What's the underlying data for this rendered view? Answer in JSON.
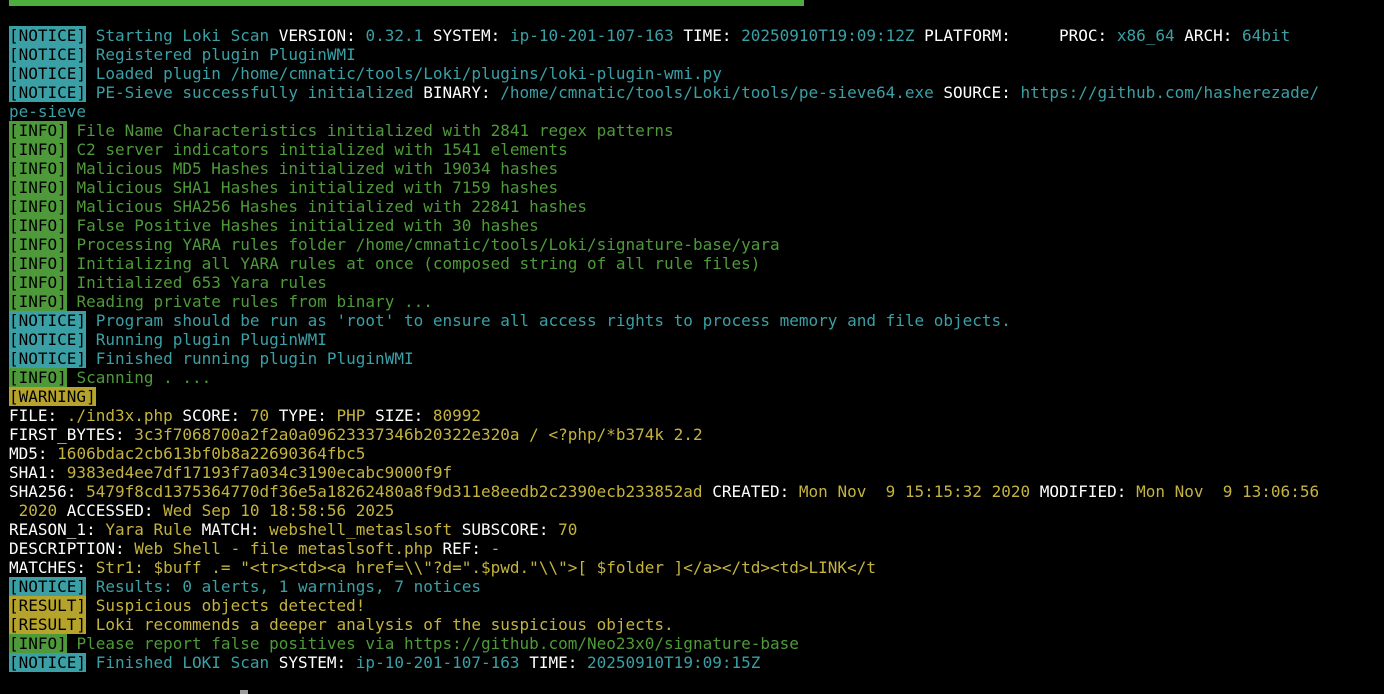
{
  "progress": {
    "fraction": 0.58
  },
  "lines": [
    [
      [
        "notice",
        "[NOTICE]"
      ],
      [
        "sp",
        " "
      ],
      [
        "nm",
        "Starting Loki Scan "
      ],
      [
        "k",
        "VERSION: "
      ],
      [
        "v",
        "0.32.1 "
      ],
      [
        "k",
        "SYSTEM: "
      ],
      [
        "v",
        "ip-10-201-107-163 "
      ],
      [
        "k",
        "TIME: "
      ],
      [
        "v",
        "20250910T19:09:12Z "
      ],
      [
        "k",
        "PLATFORM:     "
      ],
      [
        "k",
        "PROC: "
      ],
      [
        "v",
        "x86_64 "
      ],
      [
        "k",
        "ARCH: "
      ],
      [
        "v",
        "64bit"
      ]
    ],
    [
      [
        "notice",
        "[NOTICE]"
      ],
      [
        "sp",
        " "
      ],
      [
        "nm",
        "Registered plugin PluginWMI"
      ]
    ],
    [
      [
        "notice",
        "[NOTICE]"
      ],
      [
        "sp",
        " "
      ],
      [
        "nm",
        "Loaded plugin /home/cmnatic/tools/Loki/plugins/loki-plugin-wmi.py"
      ]
    ],
    [
      [
        "notice",
        "[NOTICE]"
      ],
      [
        "sp",
        " "
      ],
      [
        "nm",
        "PE-Sieve successfully initialized "
      ],
      [
        "k",
        "BINARY: "
      ],
      [
        "v",
        "/home/cmnatic/tools/Loki/tools/pe-sieve64.exe "
      ],
      [
        "k",
        "SOURCE: "
      ],
      [
        "v",
        "https://github.com/hasherezade/"
      ]
    ],
    [
      [
        "v",
        "pe-sieve"
      ]
    ],
    [
      [
        "info",
        "[INFO]"
      ],
      [
        "sp",
        " "
      ],
      [
        "im",
        "File Name Characteristics initialized with 2841 regex patterns"
      ]
    ],
    [
      [
        "info",
        "[INFO]"
      ],
      [
        "sp",
        " "
      ],
      [
        "im",
        "C2 server indicators initialized with 1541 elements"
      ]
    ],
    [
      [
        "info",
        "[INFO]"
      ],
      [
        "sp",
        " "
      ],
      [
        "im",
        "Malicious MD5 Hashes initialized with 19034 hashes"
      ]
    ],
    [
      [
        "info",
        "[INFO]"
      ],
      [
        "sp",
        " "
      ],
      [
        "im",
        "Malicious SHA1 Hashes initialized with 7159 hashes"
      ]
    ],
    [
      [
        "info",
        "[INFO]"
      ],
      [
        "sp",
        " "
      ],
      [
        "im",
        "Malicious SHA256 Hashes initialized with 22841 hashes"
      ]
    ],
    [
      [
        "info",
        "[INFO]"
      ],
      [
        "sp",
        " "
      ],
      [
        "im",
        "False Positive Hashes initialized with 30 hashes"
      ]
    ],
    [
      [
        "info",
        "[INFO]"
      ],
      [
        "sp",
        " "
      ],
      [
        "im",
        "Processing YARA rules folder /home/cmnatic/tools/Loki/signature-base/yara"
      ]
    ],
    [
      [
        "info",
        "[INFO]"
      ],
      [
        "sp",
        " "
      ],
      [
        "im",
        "Initializing all YARA rules at once (composed string of all rule files)"
      ]
    ],
    [
      [
        "info",
        "[INFO]"
      ],
      [
        "sp",
        " "
      ],
      [
        "im",
        "Initialized 653 Yara rules"
      ]
    ],
    [
      [
        "info",
        "[INFO]"
      ],
      [
        "sp",
        " "
      ],
      [
        "im",
        "Reading private rules from binary ..."
      ]
    ],
    [
      [
        "notice",
        "[NOTICE]"
      ],
      [
        "sp",
        " "
      ],
      [
        "nm",
        "Program should be run as 'root' to ensure all access rights to process memory and file objects."
      ]
    ],
    [
      [
        "notice",
        "[NOTICE]"
      ],
      [
        "sp",
        " "
      ],
      [
        "nm",
        "Running plugin PluginWMI"
      ]
    ],
    [
      [
        "notice",
        "[NOTICE]"
      ],
      [
        "sp",
        " "
      ],
      [
        "nm",
        "Finished running plugin PluginWMI"
      ]
    ],
    [
      [
        "info",
        "[INFO]"
      ],
      [
        "sp",
        " "
      ],
      [
        "im",
        "Scanning . ..."
      ]
    ],
    [
      [
        "warn",
        "[WARNING]"
      ]
    ],
    [
      [
        "k",
        "FILE: "
      ],
      [
        "y",
        "./ind3x.php "
      ],
      [
        "k",
        "SCORE: "
      ],
      [
        "y",
        "70 "
      ],
      [
        "k",
        "TYPE: "
      ],
      [
        "y",
        "PHP "
      ],
      [
        "k",
        "SIZE: "
      ],
      [
        "y",
        "80992"
      ]
    ],
    [
      [
        "k",
        "FIRST_BYTES: "
      ],
      [
        "y",
        "3c3f7068700a2f2a0a09623337346b20322e320a / <?php/*b374k 2.2"
      ]
    ],
    [
      [
        "k",
        "MD5: "
      ],
      [
        "y",
        "1606bdac2cb613bf0b8a22690364fbc5"
      ]
    ],
    [
      [
        "k",
        "SHA1: "
      ],
      [
        "y",
        "9383ed4ee7df17193f7a034c3190ecabc9000f9f"
      ]
    ],
    [
      [
        "k",
        "SHA256: "
      ],
      [
        "y",
        "5479f8cd1375364770df36e5a18262480a8f9d311e8eedb2c2390ecb233852ad "
      ],
      [
        "k",
        "CREATED: "
      ],
      [
        "y",
        "Mon Nov  9 15:15:32 2020 "
      ],
      [
        "k",
        "MODIFIED: "
      ],
      [
        "y",
        "Mon Nov  9 13:06:56"
      ]
    ],
    [
      [
        "y",
        " 2020 "
      ],
      [
        "k",
        "ACCESSED: "
      ],
      [
        "y",
        "Wed Sep 10 18:58:56 2025"
      ]
    ],
    [
      [
        "k",
        "REASON_1: "
      ],
      [
        "y",
        "Yara Rule "
      ],
      [
        "k",
        "MATCH: "
      ],
      [
        "y",
        "webshell_metaslsoft "
      ],
      [
        "k",
        "SUBSCORE: "
      ],
      [
        "y",
        "70"
      ]
    ],
    [
      [
        "k",
        "DESCRIPTION: "
      ],
      [
        "y",
        "Web Shell - file metaslsoft.php "
      ],
      [
        "k",
        "REF: "
      ],
      [
        "y",
        "-"
      ]
    ],
    [
      [
        "k",
        "MATCHES: "
      ],
      [
        "y",
        "Str1: $buff .= \"<tr><td><a href=\\\\\"?d=\".$pwd.\"\\\\\">[ $folder ]</a></td><td>LINK</t"
      ]
    ],
    [
      [
        "notice",
        "[NOTICE]"
      ],
      [
        "sp",
        " "
      ],
      [
        "nm",
        "Results: 0 alerts, 1 warnings, 7 notices"
      ]
    ],
    [
      [
        "result",
        "[RESULT]"
      ],
      [
        "sp",
        " "
      ],
      [
        "rm",
        "Suspicious objects detected!"
      ]
    ],
    [
      [
        "result",
        "[RESULT]"
      ],
      [
        "sp",
        " "
      ],
      [
        "rm",
        "Loki recommends a deeper analysis of the suspicious objects."
      ]
    ],
    [
      [
        "info",
        "[INFO]"
      ],
      [
        "sp",
        " "
      ],
      [
        "im",
        "Please report false positives via https://github.com/Neo23x0/signature-base"
      ]
    ],
    [
      [
        "notice",
        "[NOTICE]"
      ],
      [
        "sp",
        " "
      ],
      [
        "nm",
        "Finished LOKI Scan "
      ],
      [
        "k",
        "SYSTEM: "
      ],
      [
        "v",
        "ip-10-201-107-163 "
      ],
      [
        "k",
        "TIME: "
      ],
      [
        "v",
        "20250910T19:09:15Z"
      ]
    ]
  ]
}
